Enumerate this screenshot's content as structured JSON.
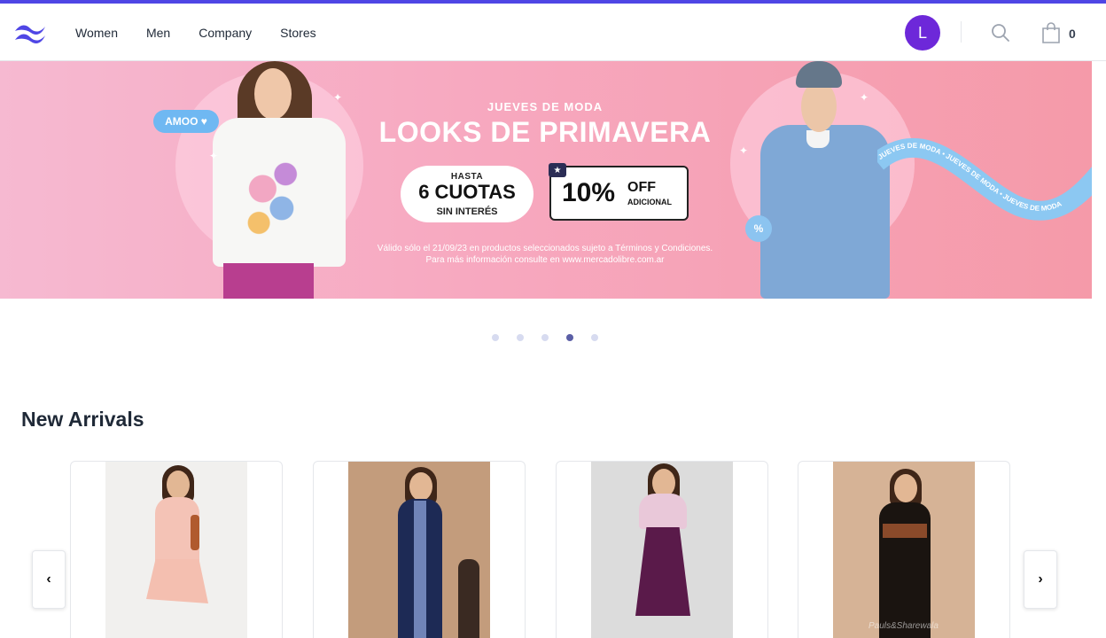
{
  "nav": {
    "links": [
      "Women",
      "Men",
      "Company",
      "Stores"
    ],
    "avatar_initial": "L",
    "cart_count": "0",
    "accent": "#4f46e5",
    "avatar_color": "#6d28d9"
  },
  "banner": {
    "badge": "AMOO ♥",
    "eyebrow": "JUEVES DE MODA",
    "title": "LOOKS DE PRIMAVERA",
    "cuotas_top": "HASTA",
    "cuotas_mid": "6 CUOTAS",
    "cuotas_bottom": "SIN INTERÉS",
    "discount_big": "10%",
    "discount_off": "OFF",
    "discount_sub": "ADICIONAL",
    "percent_badge": "%",
    "ribbon_text": "JUEVES DE MODA • JUEVES DE MODA • JUEVES DE MODA",
    "legal": "Válido sólo el 21/09/23 en productos seleccionados sujeto a Términos y Condiciones. Para más información consulte en www.mercadolibre.com.ar",
    "slides": 5,
    "active_slide": 4
  },
  "section": {
    "title": "New Arrivals"
  },
  "products": [
    {
      "dress": "pink midi dress",
      "color": "#f4c3b6"
    },
    {
      "dress": "navy printed maxi dress",
      "color": "#1d2a55"
    },
    {
      "dress": "floral top with purple pleated skirt",
      "color": "#5a1a4a"
    },
    {
      "dress": "black printed anarkali dress",
      "color": "#1a1410"
    }
  ],
  "watermark": "Pauls&Sharewala",
  "carousel": {
    "prev_icon": "chevron-left-icon",
    "next_icon": "chevron-right-icon",
    "prev_symbol": "‹",
    "next_symbol": "›"
  }
}
